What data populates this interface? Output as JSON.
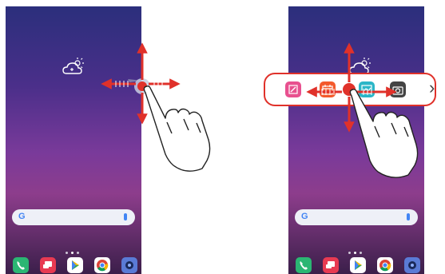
{
  "colors": {
    "arrow": "#e0312a",
    "wallpaper_top": "#2b2f7c",
    "wallpaper_bottom": "#3b1f4a",
    "tray_border": "#e0312a"
  },
  "phones": [
    {
      "search_logo": "G",
      "icons": [
        "weather-icon",
        "google-g-icon",
        "mic-icon"
      ],
      "page_dots": 3
    },
    {
      "search_logo": "G",
      "icons": [
        "weather-icon",
        "google-g-icon",
        "mic-icon"
      ],
      "page_dots": 3
    }
  ],
  "dock": [
    {
      "name": "phone-app-icon",
      "color": "#2bb673"
    },
    {
      "name": "messages-app-icon",
      "color": "#e83a52"
    },
    {
      "name": "play-store-app-icon",
      "color": "#ffffff"
    },
    {
      "name": "chrome-app-icon",
      "color": "#ffffff"
    },
    {
      "name": "camera-app-icon",
      "color": "#5a7bd6"
    }
  ],
  "edge_tray": {
    "chevron": "›",
    "items": [
      {
        "name": "edit-app-icon",
        "color": "#e8508f"
      },
      {
        "name": "calendar-app-icon",
        "color": "#f35a2c"
      },
      {
        "name": "selected-handle-icon",
        "color": "#e0312a"
      },
      {
        "name": "gallery-app-icon",
        "color": "#2ab6c7"
      },
      {
        "name": "camera-app-icon",
        "color": "#444444"
      }
    ]
  },
  "gestures": [
    "swipe-up",
    "swipe-down",
    "swipe-left",
    "swipe-right"
  ]
}
